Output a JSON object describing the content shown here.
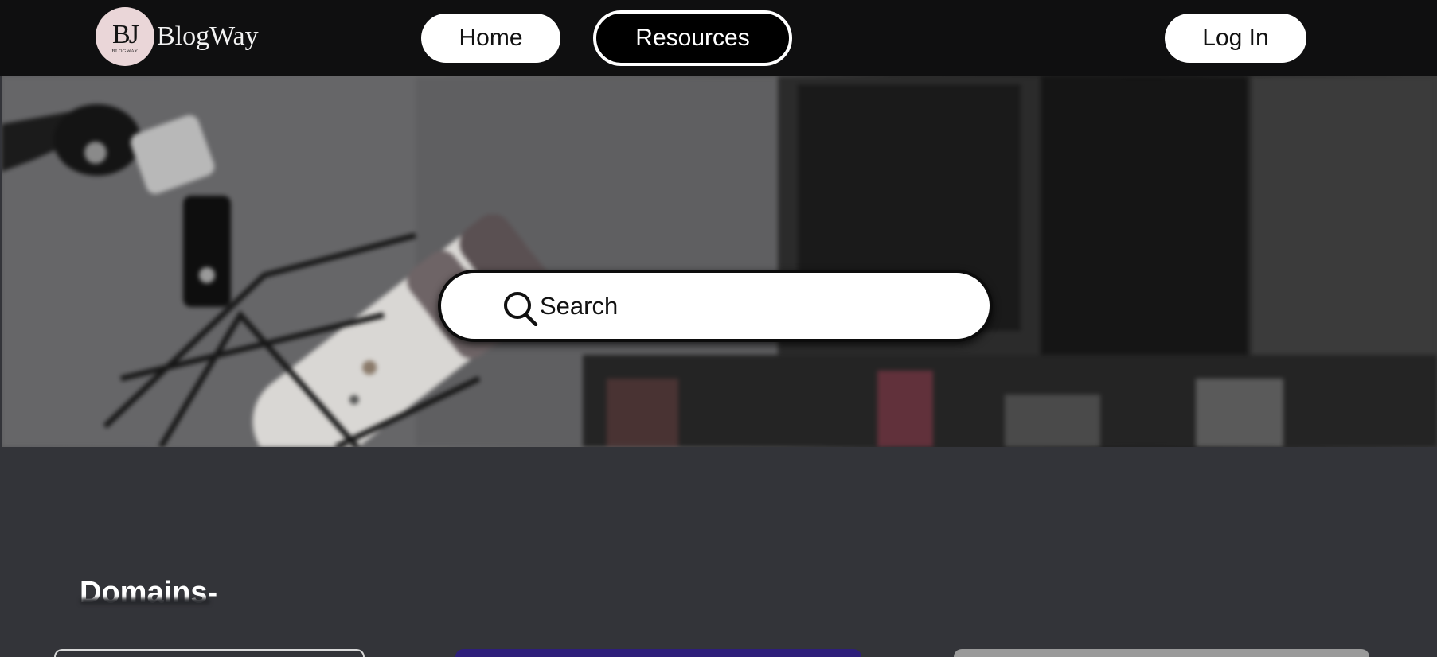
{
  "navbar": {
    "logo_monogram": "BJ",
    "logo_tagline": "BLOGWAY",
    "brand": "BlogWay",
    "home_label": "Home",
    "resources_label": "Resources",
    "login_label": "Log In"
  },
  "hero": {
    "search_label": "Search",
    "search_icon": "search-icon"
  },
  "domains": {
    "title": "Domains-"
  },
  "colors": {
    "navbar_bg": "#0f0f10",
    "page_bg": "#333439",
    "logo_badge": "#ead6d8",
    "active_button_bg": "#000000",
    "button_bg": "#ffffff"
  }
}
